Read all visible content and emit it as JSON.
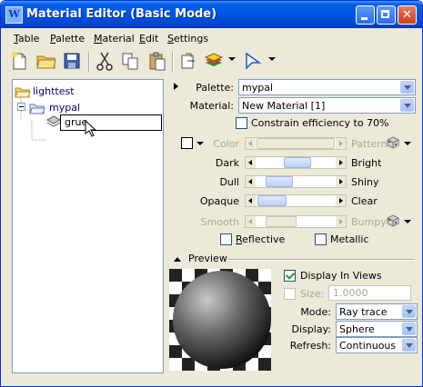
{
  "window": {
    "title": "Material Editor (Basic Mode)",
    "app_icon_letter": "W",
    "title_bar_color": "#0055e5",
    "controls": [
      "minimize-icon",
      "maximize-icon",
      "close-icon"
    ]
  },
  "menu": [
    {
      "label": "Table",
      "mnemonic": "T",
      "rest": "able"
    },
    {
      "label": "Palette",
      "mnemonic": "P",
      "rest": "alette"
    },
    {
      "label": "Material",
      "mnemonic": "M",
      "rest": "aterial"
    },
    {
      "label": "Edit",
      "mnemonic": "E",
      "rest": "dit"
    },
    {
      "label": "Settings",
      "mnemonic": "S",
      "rest": "ettings"
    }
  ],
  "toolbar": {
    "icons": [
      "new-file-icon",
      "open-folder-icon",
      "save-icon",
      "cut-icon",
      "copy-icon",
      "paste-icon",
      "paste-special-icon",
      "palette-layers-icon",
      "pointer-icon"
    ]
  },
  "tree": {
    "root": "lighttest",
    "palette": "mypal",
    "editing_material": "grue"
  },
  "properties": {
    "palette_label": "Palette:",
    "palette_value": "mypal",
    "material_label": "Material:",
    "material_value": "New Material [1]",
    "constrain_label": "Constrain efficiency to 70%",
    "constrain_checked": false,
    "color_label": "Color",
    "pattern_label": "Pattern",
    "dark_label": "Dark",
    "bright_label": "Bright",
    "dark_bright_value": 0.5,
    "dull_label": "Dull",
    "shiny_label": "Shiny",
    "dull_shiny_value": 0.25,
    "opaque_label": "Opaque",
    "clear_label": "Clear",
    "opaque_clear_value": 0.15,
    "smooth_label": "Smooth",
    "bumpy_label": "Bumpy",
    "smooth_bumpy_value": 0.35,
    "reflective_label": "Reflective",
    "reflective_mnemonic": "R",
    "reflective_rest": "eflective",
    "reflective_checked": false,
    "metallic_label": "Metallic",
    "metallic_checked": false
  },
  "preview": {
    "section_label": "Preview",
    "display_in_views_label": "Display In Views",
    "display_in_views_checked": true,
    "size_label": "Size:",
    "size_value": "1.0000",
    "mode_label": "Mode:",
    "mode_value": "Ray trace",
    "display_label": "Display:",
    "display_value": "Sphere",
    "refresh_label": "Refresh:",
    "refresh_value": "Continuous"
  }
}
